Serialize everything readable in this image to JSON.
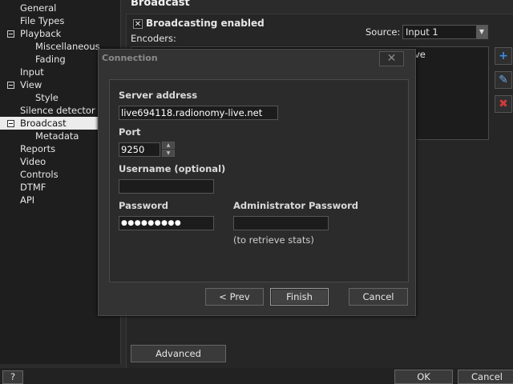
{
  "sidebar": {
    "items": [
      {
        "label": "General",
        "indent": 1,
        "expander": false,
        "selected": false
      },
      {
        "label": "File Types",
        "indent": 1,
        "expander": false,
        "selected": false
      },
      {
        "label": "Playback",
        "indent": 1,
        "expander": true,
        "selected": false
      },
      {
        "label": "Miscellaneous",
        "indent": 2,
        "expander": false,
        "selected": false
      },
      {
        "label": "Fading",
        "indent": 2,
        "expander": false,
        "selected": false
      },
      {
        "label": "Input",
        "indent": 1,
        "expander": false,
        "selected": false
      },
      {
        "label": "View",
        "indent": 1,
        "expander": true,
        "selected": false
      },
      {
        "label": "Style",
        "indent": 2,
        "expander": false,
        "selected": false
      },
      {
        "label": "Silence detector",
        "indent": 1,
        "expander": false,
        "selected": false
      },
      {
        "label": "Broadcast",
        "indent": 1,
        "expander": true,
        "selected": true
      },
      {
        "label": "Metadata",
        "indent": 2,
        "expander": false,
        "selected": false
      },
      {
        "label": "Reports",
        "indent": 1,
        "expander": false,
        "selected": false
      },
      {
        "label": "Video",
        "indent": 1,
        "expander": false,
        "selected": false
      },
      {
        "label": "Controls",
        "indent": 1,
        "expander": false,
        "selected": false
      },
      {
        "label": "DTMF",
        "indent": 1,
        "expander": false,
        "selected": false
      },
      {
        "label": "API",
        "indent": 1,
        "expander": false,
        "selected": false
      }
    ]
  },
  "page": {
    "title": "Broadcast",
    "broadcasting_enabled": {
      "checked": true,
      "mark": "✕",
      "label": "Broadcasting enabled"
    },
    "encoders_label": "Encoders:",
    "source_label": "Source:",
    "source_value": "Input 1",
    "list_partial_text": "ve",
    "advanced_button": "Advanced",
    "side_buttons": [
      {
        "icon": "plus-icon",
        "glyph": "+",
        "color": "#3a8ee6"
      },
      {
        "icon": "edit-icon",
        "glyph": "✎",
        "color": "#6aa7e8"
      },
      {
        "icon": "delete-icon",
        "glyph": "✖",
        "color": "#d23a3a"
      }
    ]
  },
  "dialog": {
    "title": "Connection",
    "close_glyph": "✕",
    "server_address_label": "Server address",
    "server_address_value": "live694118.radionomy-live.net",
    "port_label": "Port",
    "port_value": "9250",
    "username_label": "Username (optional)",
    "username_value": "",
    "password_label": "Password",
    "password_value": "●●●●●●●●●",
    "admin_password_label": "Administrator Password",
    "admin_password_value": "",
    "admin_hint": "(to retrieve stats)",
    "prev_button": "< Prev",
    "finish_button": "Finish",
    "cancel_button": "Cancel"
  },
  "footer": {
    "help_button": "?",
    "ok_button": "OK",
    "cancel_button": "Cancel"
  }
}
